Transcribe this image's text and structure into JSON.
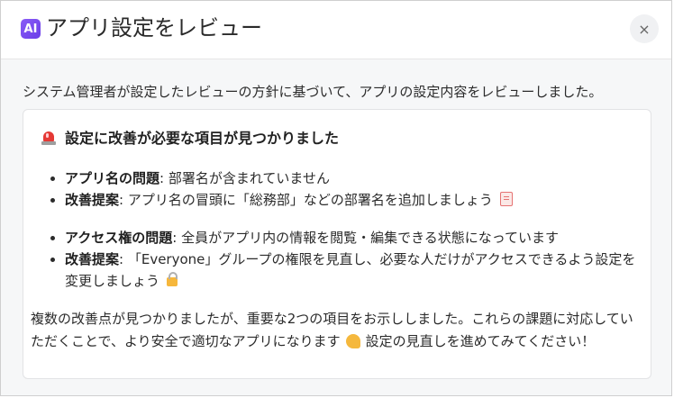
{
  "header": {
    "badge": "AI",
    "title": "アプリ設定をレビュー",
    "close_label": "×"
  },
  "intro": "システム管理者が設定したレビューの方針に基づいて、アプリの設定内容をレビューしました。",
  "card": {
    "title": "設定に改善が必要な項目が見つかりました",
    "items": [
      {
        "issue_label": "アプリ名の問題",
        "issue_text": ": 部署名が含まれていません",
        "suggestion_label": "改善提案",
        "suggestion_text": ": アプリ名の冒頭に「総務部」などの部署名を追加しましょう"
      },
      {
        "issue_label": "アクセス権の問題",
        "issue_text": ": 全員がアプリ内の情報を閲覧・編集できる状態になっています",
        "suggestion_label": "改善提案",
        "suggestion_text": ": 「Everyone」グループの権限を見直し、必要な人だけがアクセスできるよう設定を変更しましょう"
      }
    ],
    "summary_part1": "複数の改善点が見つかりましたが、重要な2つの項目をお示ししました。これらの課題に対応していただくことで、より安全で適切なアプリになります",
    "summary_part2": "設定の見直しを進めてみてください！"
  },
  "icons": {
    "title_icon": "siren-icon",
    "item1_icon": "memo-icon",
    "item2_icon": "lock-icon",
    "summary_icon": "flexed-biceps-icon"
  },
  "colors": {
    "accent": "#7c4dff",
    "siren": "#e53935"
  }
}
